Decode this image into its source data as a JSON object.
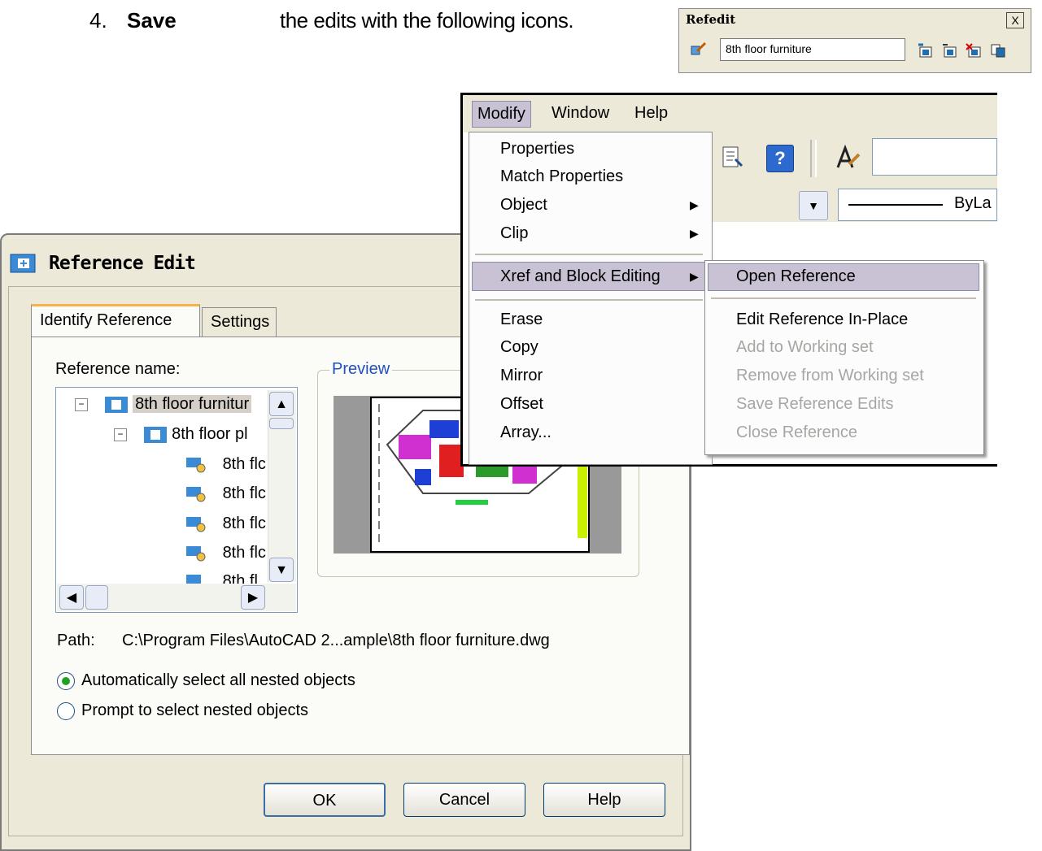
{
  "instruction": {
    "number": "4.",
    "verb": "Save",
    "text": "the edits with the following icons."
  },
  "refedit": {
    "title": "Refedit",
    "close_glyph": "X",
    "reference_value": "8th floor furniture",
    "icons": [
      "edit-reference-icon",
      "add-to-set-icon",
      "remove-from-set-icon",
      "discard-changes-icon",
      "save-back-icon"
    ]
  },
  "dialog": {
    "title": "Reference Edit",
    "tabs": [
      {
        "label": "Identify Reference"
      },
      {
        "label": "Settings"
      }
    ],
    "reference_name_label": "Reference name:",
    "tree": [
      {
        "label": "8th floor furnitur"
      },
      {
        "label": "8th floor pl"
      },
      {
        "label": "8th flc"
      },
      {
        "label": "8th flc"
      },
      {
        "label": "8th flc"
      },
      {
        "label": "8th flc"
      },
      {
        "label": "8th fl"
      }
    ],
    "preview_label": "Preview",
    "path_label": "Path:",
    "path_value": "C:\\Program Files\\AutoCAD 2...ample\\8th floor furniture.dwg",
    "options": [
      {
        "label": "Automatically select all nested objects",
        "selected": true
      },
      {
        "label": "Prompt to select nested objects",
        "selected": false
      }
    ],
    "buttons": {
      "ok": "OK",
      "cancel": "Cancel",
      "help": "Help"
    }
  },
  "menubar": {
    "items": [
      {
        "label": "Modify"
      },
      {
        "label": "Window"
      },
      {
        "label": "Help"
      }
    ]
  },
  "toolbar": {
    "linetype": "ByLa",
    "help_glyph": "?"
  },
  "modify_menu": {
    "items": [
      {
        "label": "Properties"
      },
      {
        "label": "Match Properties"
      },
      {
        "label": "Object"
      },
      {
        "label": "Clip"
      },
      {
        "label": "Xref and Block Editing"
      },
      {
        "label": "Erase"
      },
      {
        "label": "Copy"
      },
      {
        "label": "Mirror"
      },
      {
        "label": "Offset"
      },
      {
        "label": "Array..."
      }
    ],
    "submenu": [
      {
        "label": "Open Reference"
      },
      {
        "label": "Edit Reference In-Place"
      },
      {
        "label": "Add to Working set"
      },
      {
        "label": "Remove from Working set"
      },
      {
        "label": "Save Reference Edits"
      },
      {
        "label": "Close Reference"
      }
    ]
  },
  "colors": {
    "menu_highlight": "#c8c2d4",
    "dialog_bg": "#ece9d8",
    "preview_accent": "#2050c0"
  }
}
